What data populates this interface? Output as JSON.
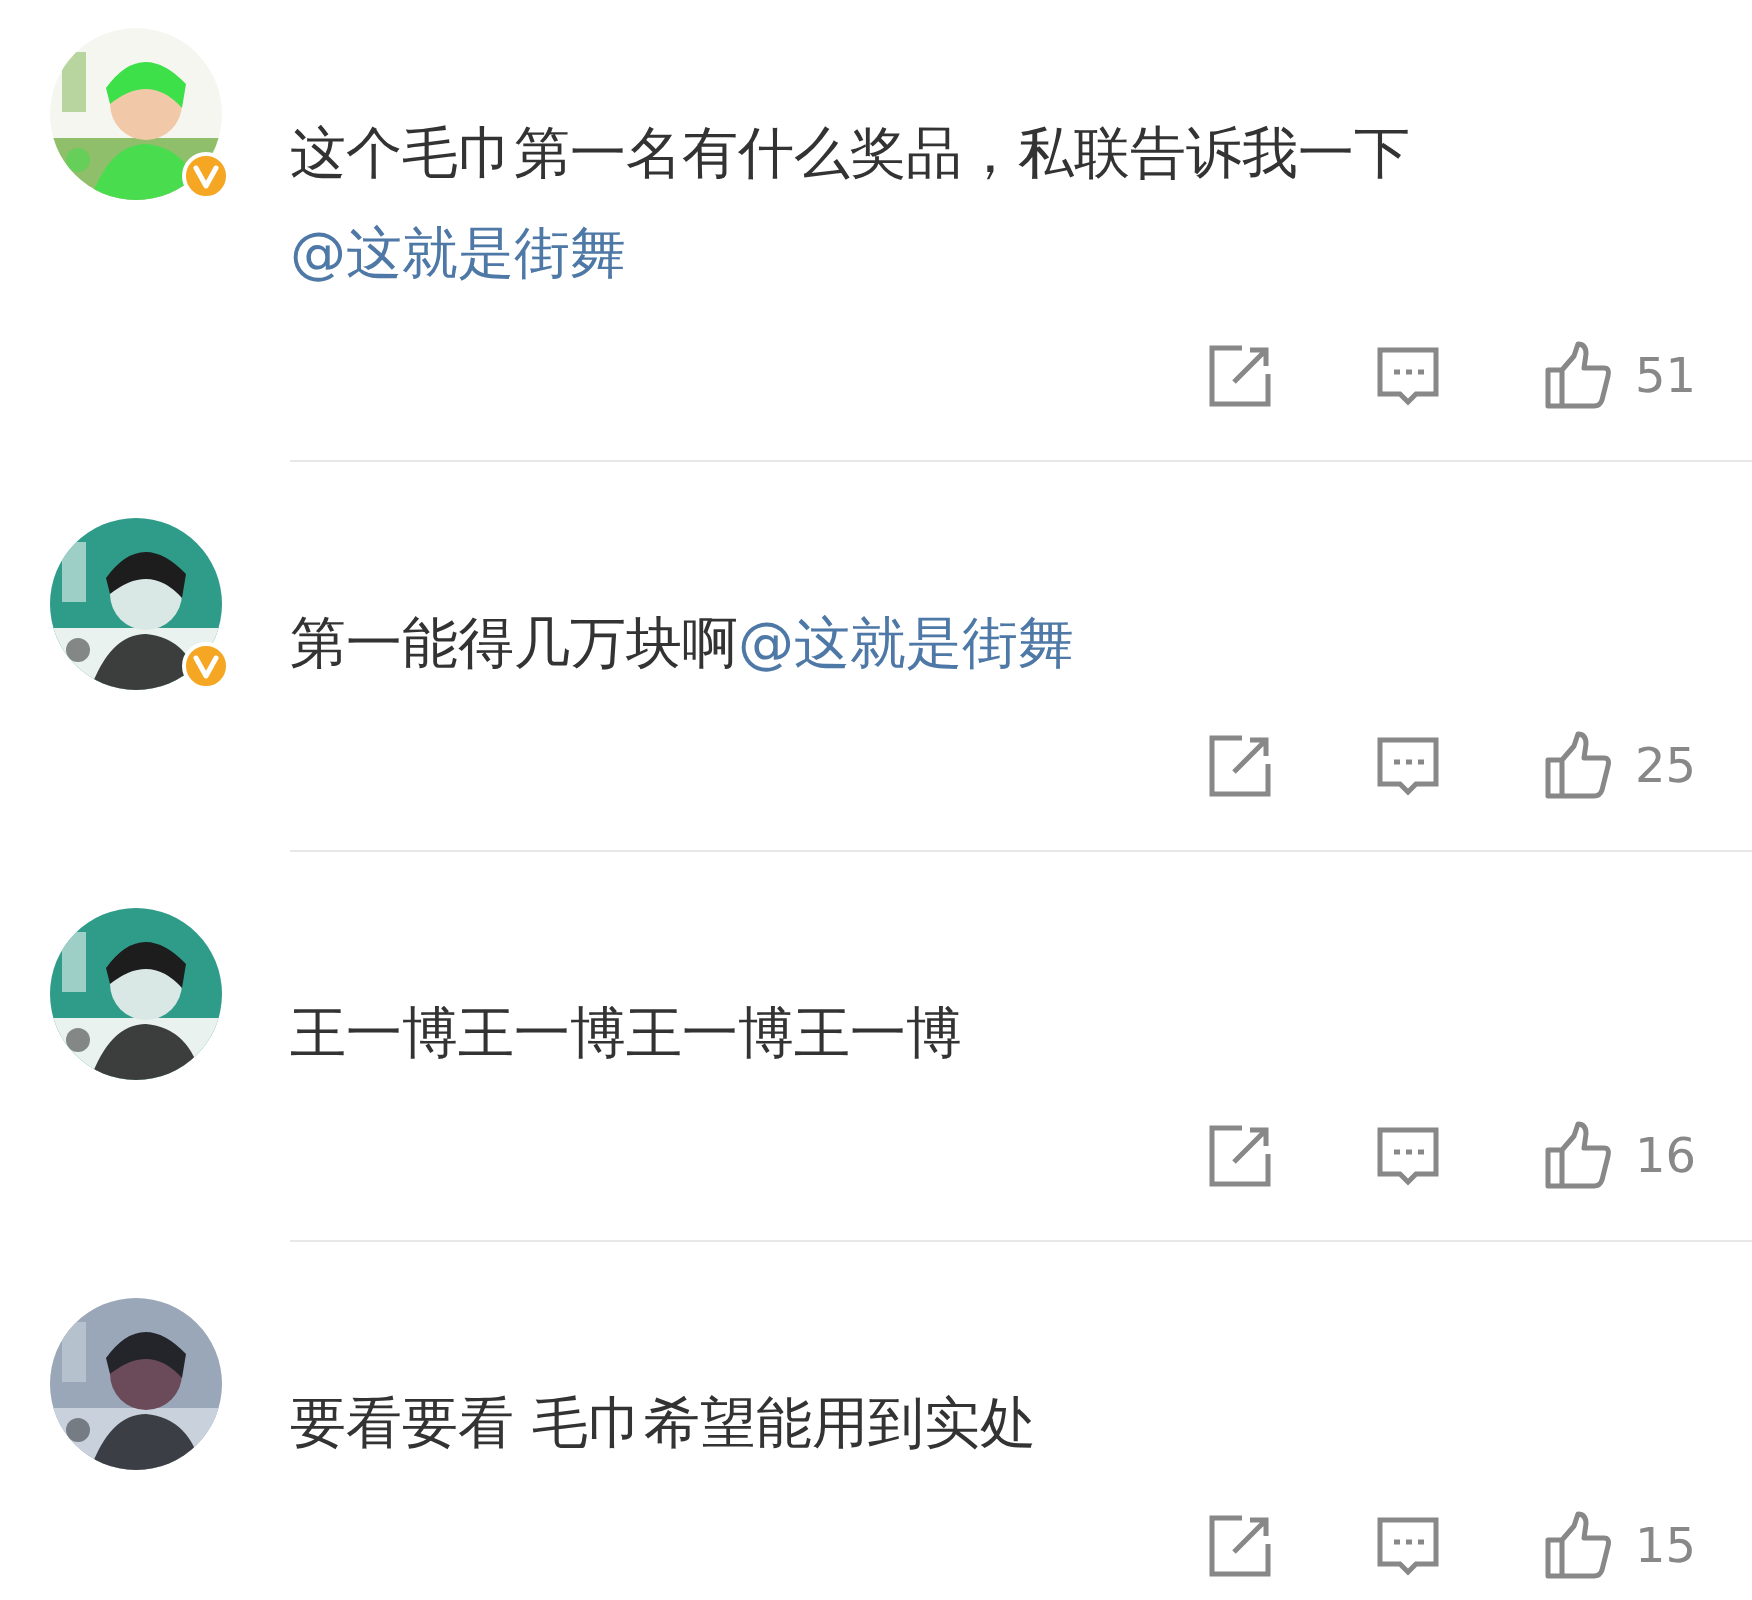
{
  "comments": [
    {
      "verified": true,
      "text": "这个毛巾第一名有什么奖品，私联告诉我一下",
      "mention": "@这就是街舞",
      "likes": "51"
    },
    {
      "verified": true,
      "text": "第一能得几万块啊",
      "mention": "@这就是街舞",
      "likes": "25"
    },
    {
      "verified": false,
      "text": "王一博王一博王一博王一博",
      "likes": "16"
    },
    {
      "verified": false,
      "text": "要看要看 毛巾希望能用到实处",
      "likes": "15"
    }
  ]
}
